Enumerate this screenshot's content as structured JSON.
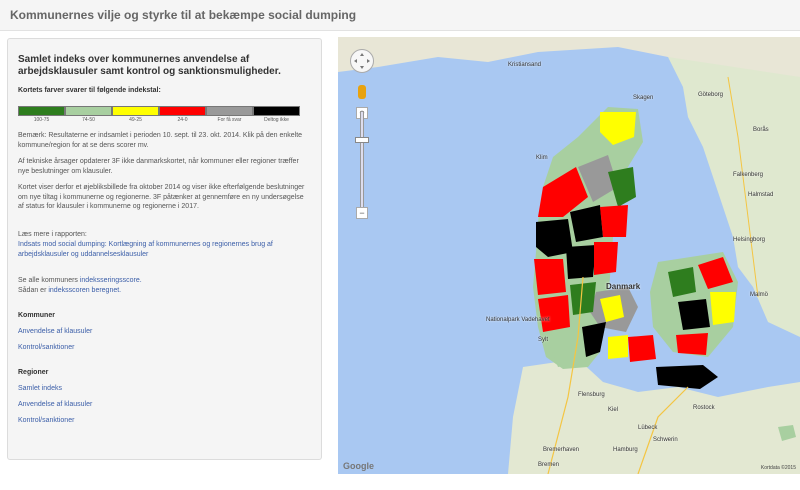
{
  "page": {
    "title": "Kommunernes vilje og styrke til at bekæmpe social dumping"
  },
  "sidebar": {
    "heading": "Samlet indeks over kommunernes anvendelse af arbejdsklausuler samt kontrol og sanktionsmuligheder.",
    "legend_title": "Kortets farver svarer til følgende indekstal:",
    "legend": [
      {
        "label": "100-75",
        "color": "#2e7d1e"
      },
      {
        "label": "74-50",
        "color": "#a8cfa0"
      },
      {
        "label": "49-25",
        "color": "#ffff00"
      },
      {
        "label": "24-0",
        "color": "#ff0000"
      },
      {
        "label": "For få svar",
        "color": "#999999"
      },
      {
        "label": "Deltog ikke",
        "color": "#000000"
      }
    ],
    "note1": "Bemærk: Resultaterne er indsamlet i perioden 10. sept. til 23. okt. 2014. Klik på den enkelte kommune/region for at se dens scorer mv.",
    "note2": "Af tekniske årsager opdaterer 3F ikke danmarkskortet, når kommuner eller regioner træffer nye beslutninger om klausuler.",
    "note3": "Kortet viser derfor et øjebliksbillede fra oktober 2014 og viser ikke efterfølgende beslutninger om nye tiltag i kommunerne og regionerne. 3F påtænker at gennemføre en ny undersøgelse af status for klausuler i kommunerne og regionerne i 2017.",
    "read_more": "Læs mere i rapporten:",
    "report_link": "Indsats mod social dumping: Kortlægning af kommunernes og regionernes brug af arbejdsklausuler og uddannelsesklausuler",
    "scores_prefix": "Se alle kommuners ",
    "scores_link": "indeksseringsscore.",
    "method_prefix": "Sådan er ",
    "method_link": "indeksscoren beregnet.",
    "kommuner_heading": "Kommuner",
    "kommuner_links": [
      "Anvendelse af klausuler",
      "Kontrol/sanktioner"
    ],
    "regioner_heading": "Regioner",
    "regioner_links": [
      "Samlet indeks",
      "Anvendelse af klausuler",
      "Kontrol/sanktioner"
    ]
  },
  "map": {
    "labels": {
      "kristiansand": "Kristiansand",
      "goteborg": "Göteborg",
      "borås": "Borås",
      "falkenberg": "Falkenberg",
      "halmstad": "Halmstad",
      "helsingborg": "Helsingborg",
      "malmo": "Malmö",
      "danmark": "Danmark",
      "nationalpark": "Nationalpark Vadehavet",
      "sylt": "Sylt",
      "flensburg": "Flensburg",
      "kiel": "Kiel",
      "lubeck": "Lübeck",
      "rostock": "Rostock",
      "hamburg": "Hamburg",
      "schwerin": "Schwerin",
      "bremerhaven": "Bremerhaven",
      "bremen": "Bremen",
      "skagen": "Skagen",
      "klim": "Klim"
    },
    "zoom_plus": "+",
    "zoom_minus": "−",
    "logo": "Google",
    "attribution": "Kortdata ©2015"
  }
}
